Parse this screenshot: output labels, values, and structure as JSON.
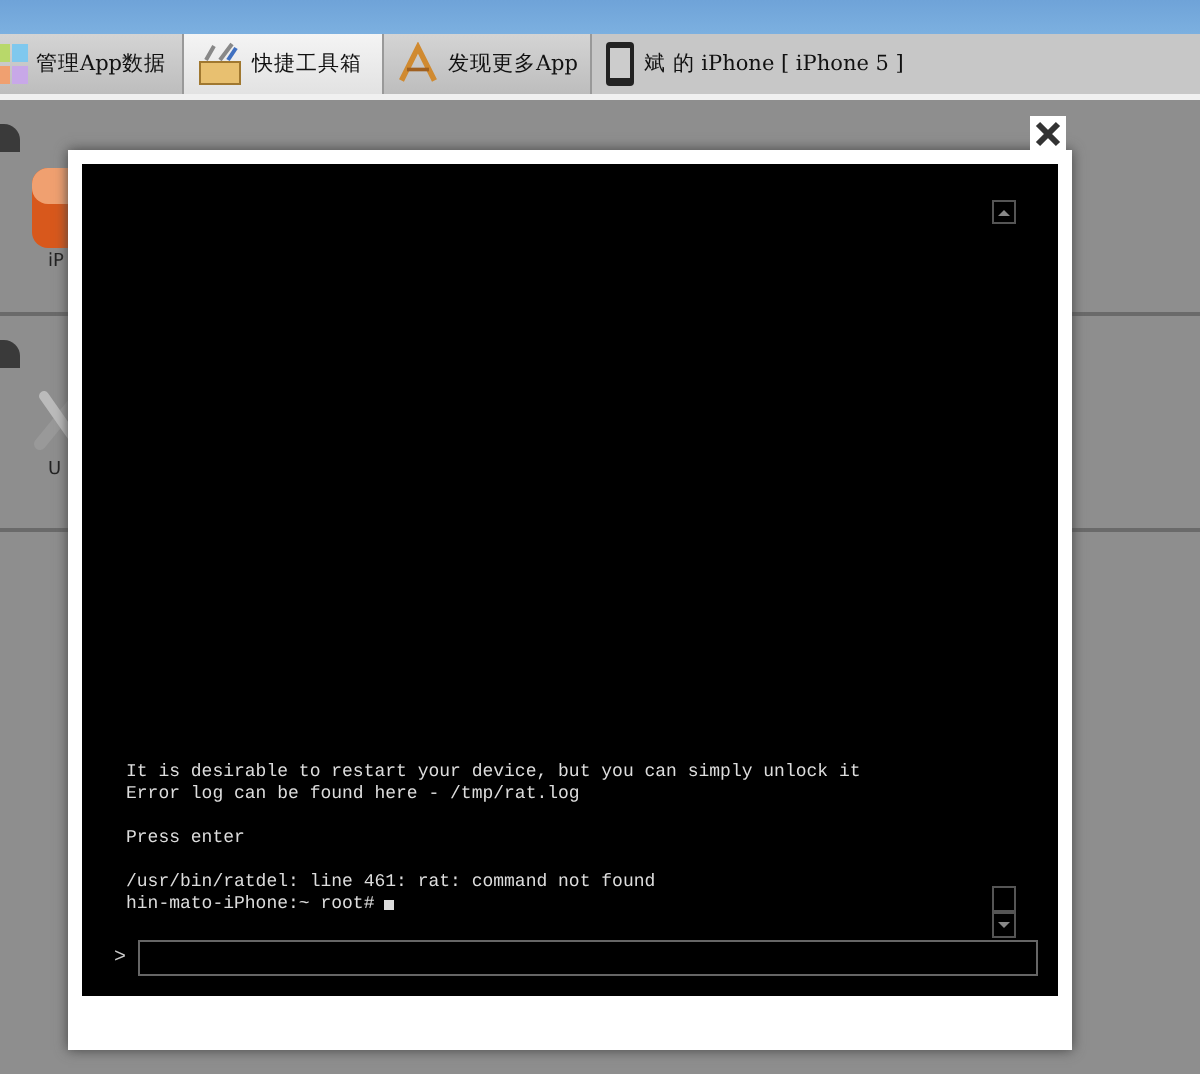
{
  "tabs": [
    {
      "label": "管理App数据",
      "selected": false
    },
    {
      "label": "快捷工具箱",
      "selected": true
    },
    {
      "label": "发现更多App",
      "selected": false
    },
    {
      "label": "斌 的 iPhone [ iPhone 5 ]",
      "selected": false
    }
  ],
  "sections": [
    {
      "label": "iP"
    },
    {
      "label": "U"
    }
  ],
  "terminal": {
    "blocks": [
      [
        "It is desirable to restart your device, but you can simply unlock it",
        "Error log can be found here - /tmp/rat.log"
      ],
      [
        "Press enter"
      ],
      [
        "/usr/bin/ratdel: line 461: rat: command not found",
        "hin-mato-iPhone:~ root#"
      ]
    ],
    "cursor": true,
    "prompt": ">"
  }
}
